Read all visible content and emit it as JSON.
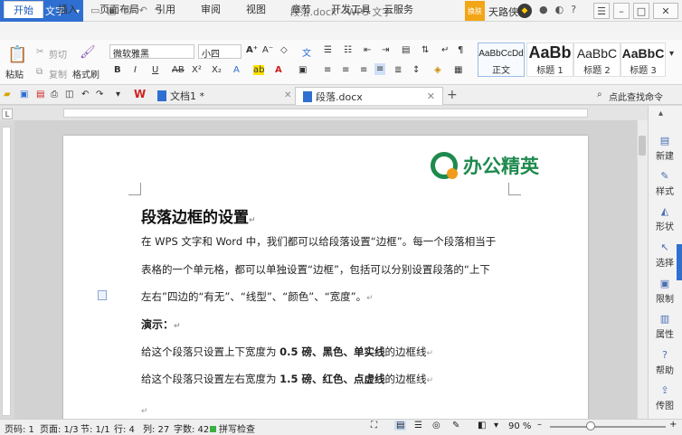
{
  "app": {
    "name": "WPS 文字",
    "window_title": "段落.docx - WPS 文字",
    "skin_label": "换肤",
    "user_name": "天路侠"
  },
  "menu": {
    "tabs": [
      "开始",
      "插入",
      "页面布局",
      "引用",
      "审阅",
      "视图",
      "章节",
      "开发工具",
      "云服务"
    ],
    "active": "开始"
  },
  "ribbon": {
    "paste_label": "粘贴",
    "cut_label": "剪切",
    "copy_label": "复制",
    "format_painter_label": "格式刷",
    "font_name": "微软雅黑",
    "font_size": "小四",
    "styles": [
      {
        "preview": "AaBbCcDd",
        "label": "正文"
      },
      {
        "preview": "AaBb",
        "label": "标题 1"
      },
      {
        "preview": "AaBbC",
        "label": "标题 2"
      },
      {
        "preview": "AaBbC",
        "label": "标题 3"
      }
    ],
    "accent_color": "#2f6fd1"
  },
  "doc_tabs": [
    {
      "label": "文档1 *",
      "active": false
    },
    {
      "label": "段落.docx",
      "active": true
    }
  ],
  "search_cmd_label": "点此查找命令",
  "document": {
    "logo_text": "办公精英",
    "heading": "段落边框的设置",
    "para1_line1": "在 WPS 文字和 Word 中，我们都可以给段落设置“边框”。每一个段落相当于",
    "para1_line2": "表格的一个单元格，都可以单独设置“边框”，包括可以分别设置段落的“上下",
    "para1_line3": "左右”四边的“有无”、“线型”、“颜色”、“宽度”。",
    "demo_label": "演示：",
    "line_a_prefix": "给这个段落只设置上下宽度为 ",
    "line_a_bold": "0.5 磅、黑色、单实线",
    "line_a_suffix": "的边框线",
    "line_b_prefix": "给这个段落只设置左右宽度为 ",
    "line_b_bold": "1.5 磅、红色、点虚线",
    "line_b_suffix": "的边框线",
    "brand_green": "#1e8a4e",
    "brand_orange": "#f29a1b"
  },
  "side_panel": [
    "新建",
    "样式",
    "形状",
    "选择",
    "限制",
    "属性",
    "帮助",
    "传图"
  ],
  "status": {
    "page_num": "页码: 1",
    "pages": "页面: 1/3",
    "section": "节: 1/1",
    "row": "行: 4",
    "col": "列: 27",
    "words": "字数: 425",
    "spell": "拼写检查",
    "zoom": "90 %"
  }
}
